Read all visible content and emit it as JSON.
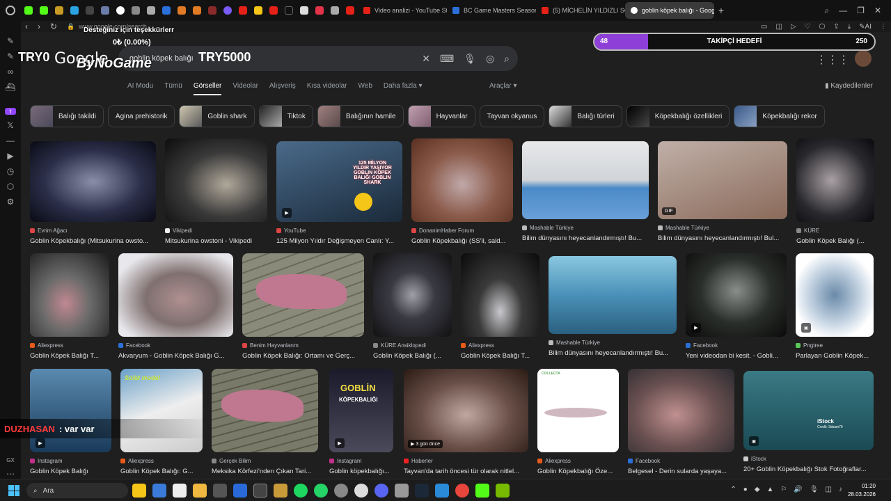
{
  "browser": {
    "tabs": [
      {
        "label": "Video analizi - YouTube Stu"
      },
      {
        "label": "BC Game Masters Season"
      },
      {
        "label": "(5) MİCHELİN YILDIZLI SO"
      },
      {
        "label": "goblin köpek balığı - Goog"
      }
    ],
    "url": "www.google.com/search"
  },
  "google": {
    "query": "goblin köpek balığı",
    "logo": "Google",
    "nav_tabs": [
      "AI Modu",
      "Tümü",
      "Görseller",
      "Videolar",
      "Alışveriş",
      "Kısa videolar",
      "Web",
      "Daha fazla"
    ],
    "active_tab": "Görseller",
    "tools": "Araçlar",
    "saved": "Kaydedilenler",
    "chips": [
      "Balığı takildi",
      "Agina prehistorik",
      "Goblin shark",
      "Tiktok",
      "Balığının hamile",
      "Hayvanlar",
      "Tayvan okyanus",
      "Balığı türleri",
      "Köpekbalığı özellikleri",
      "Köpekbalığı rekor"
    ]
  },
  "results": [
    {
      "src": "Evrim Ağacı",
      "title": "Goblin Köpekbalığı (Mitsukurina owsto..."
    },
    {
      "src": "Vikipedi",
      "title": "Mitsukurina owstoni - Vikipedi"
    },
    {
      "src": "YouTube",
      "title": "125 Milyon Yıldır Değişmeyen Canlı: Y..."
    },
    {
      "src": "DonanimHaber Forum",
      "title": "Goblin Köpekbalığı (SS'li, sald..."
    },
    {
      "src": "Mashable Türkiye",
      "title": "Bilim dünyasını heyecanlandırmıştı! Bu..."
    },
    {
      "src": "Mashable Türkiye",
      "title": "Bilim dünyasını heyecanlandırmıştı! Bul..."
    },
    {
      "src": "KÜRE",
      "title": "Goblin Köpek Balığı (..."
    },
    {
      "src": "Aliexpress",
      "title": "Goblin Köpek Balığı T..."
    },
    {
      "src": "Facebook",
      "title": "Akvaryum - Goblin Köpek Balığı G..."
    },
    {
      "src": "Benim Hayvanlarım",
      "title": "Goblin Köpek Balığı: Ortamı ve Gerç..."
    },
    {
      "src": "KÜRE Ansiklopedi",
      "title": "Goblin Köpek Balığı (..."
    },
    {
      "src": "Aliexpress",
      "title": "Goblin Köpek Balığı T..."
    },
    {
      "src": "Mashable Türkiye",
      "title": "Bilim dünyasını heyecanlandırmıştı! Bu..."
    },
    {
      "src": "Facebook",
      "title": "Yeni videodan bi kesit. - Gobli..."
    },
    {
      "src": "Pngtree",
      "title": "Parlayan Goblin Köpek..."
    },
    {
      "src": "Instagram",
      "title": "Goblin Köpek Balığı"
    },
    {
      "src": "Aliexpress",
      "title": "Goblin Köpek Balığı: G..."
    },
    {
      "src": "Gerçek Bilim",
      "title": "Meksika Körfezi'nden Çıkan Tari..."
    },
    {
      "src": "Instagram",
      "title": "Goblin köpekbalığı..."
    },
    {
      "src": "Haberler",
      "title": "Tayvan'da tarih öncesi tür olarak nitlel..."
    },
    {
      "src": "Aliexpress",
      "title": "Goblin Köpekbalığı Öze..."
    },
    {
      "src": "Facebook",
      "title": "Belgesel - Derin sularda yaşaya..."
    },
    {
      "src": "iStock",
      "title": "20+ Goblin Köpekbalığı Stok Fotoğraflar..."
    }
  ],
  "image_text": {
    "yt_overlay": "125 MİLYON YILDIR YAŞIYOR GOBLIN KÖPEK BALIĞI GOBLIN SHARK",
    "gif": "GIF",
    "ago": "3 gün önce",
    "goblin": "GOBLİN",
    "kopekbaligi": "KÖPEKBALIĞI",
    "solid": "Solid model",
    "istock": "iStock",
    "istock_credit": "Credit: 3dsam79",
    "collecta": "COLLECTA"
  },
  "overlay": {
    "donate": "Desteğiniz için teşekkürlerr",
    "amount": "0₺ (0.00%)",
    "try0": "TRY0",
    "bynogame": "ByNoGame",
    "try5000": "TRY5000",
    "goal": {
      "current": "48",
      "label": "TAKİPÇİ HEDEFİ",
      "target": "250",
      "fraction": 0.192
    },
    "chat_user": "DUZHASAN",
    "chat_msg": ": var var"
  },
  "taskbar": {
    "search": "Ara",
    "time": "01:20",
    "date": "28.03.2026"
  },
  "sidebar": {
    "gx": "GX"
  }
}
